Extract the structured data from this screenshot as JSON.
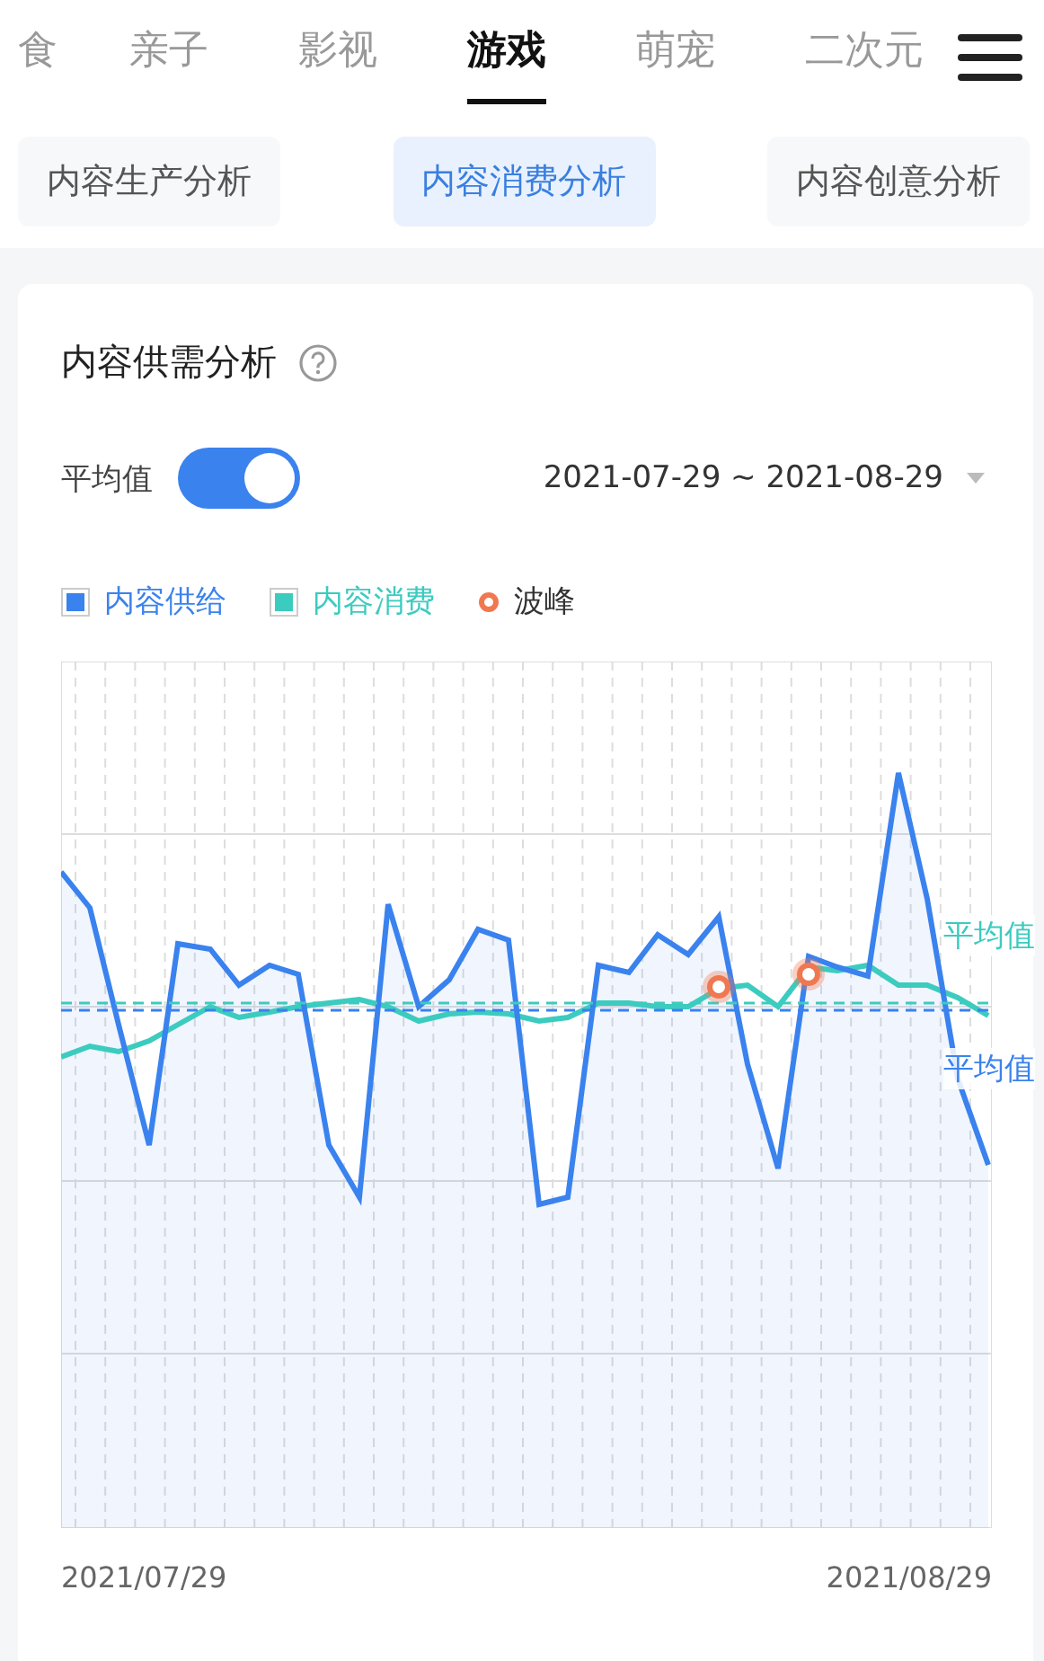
{
  "channel_tabs": [
    {
      "label": "食",
      "selected": false
    },
    {
      "label": "亲子",
      "selected": false
    },
    {
      "label": "影视",
      "selected": false
    },
    {
      "label": "游戏",
      "selected": true
    },
    {
      "label": "萌宠",
      "selected": false
    },
    {
      "label": "二次元",
      "selected": false
    }
  ],
  "analysis_tabs": [
    {
      "label": "内容生产分析",
      "selected": false
    },
    {
      "label": "内容消费分析",
      "selected": true
    },
    {
      "label": "内容创意分析",
      "selected": false
    }
  ],
  "card": {
    "title": "内容供需分析",
    "average_toggle": {
      "label": "平均值",
      "on": true
    },
    "date_range": "2021-07-29 ~ 2021-08-29",
    "legend": [
      {
        "label": "内容供给",
        "kind": "square",
        "color": "#3a82ee"
      },
      {
        "label": "内容消费",
        "kind": "square",
        "color": "#3ccbbf"
      },
      {
        "label": "波峰",
        "kind": "dot",
        "color": "#f07850"
      }
    ],
    "average_labels": [
      {
        "label": "平均值",
        "color": "#3ccbbf"
      },
      {
        "label": "平均值",
        "color": "#3a82ee"
      }
    ],
    "x_labels": [
      "2021/07/29",
      "2021/08/29"
    ]
  }
}
